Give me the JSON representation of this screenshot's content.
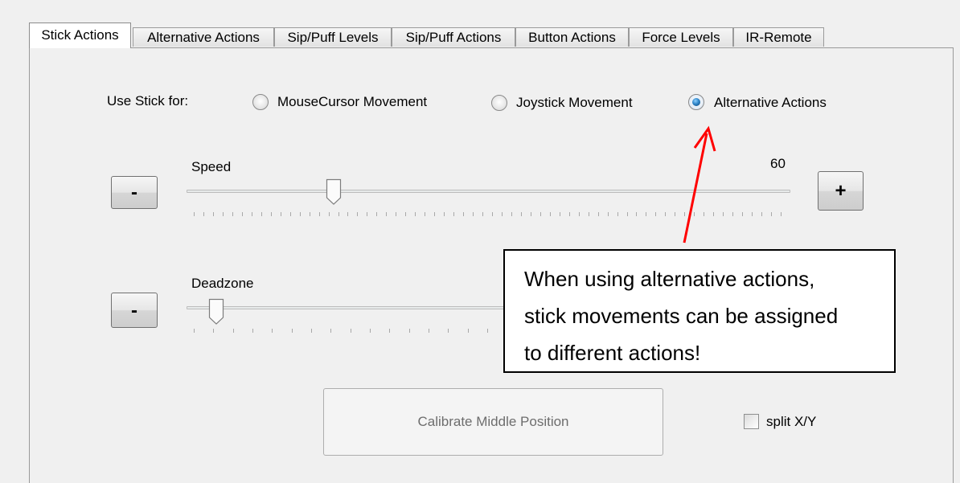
{
  "tabs": [
    {
      "label": "Stick Actions",
      "active": true
    },
    {
      "label": "Alternative Actions"
    },
    {
      "label": "Sip/Puff Levels"
    },
    {
      "label": "Sip/Puff Actions"
    },
    {
      "label": "Button Actions"
    },
    {
      "label": "Force Levels"
    },
    {
      "label": "IR-Remote"
    }
  ],
  "stick_mode": {
    "label": "Use Stick for:",
    "options": [
      {
        "label": "MouseCursor Movement",
        "checked": false
      },
      {
        "label": "Joystick Movement",
        "checked": false
      },
      {
        "label": "Alternative Actions",
        "checked": true
      }
    ]
  },
  "speed": {
    "label": "Speed",
    "value": "60",
    "minus_label": "-",
    "plus_label": "+",
    "level": 0.24
  },
  "deadzone": {
    "label": "Deadzone",
    "minus_label": "-",
    "level": 0.04
  },
  "calibrate_label": "Calibrate Middle Position",
  "split_xy": {
    "label": "split X/Y",
    "checked": false
  },
  "callout": {
    "line1": "When using alternative actions,",
    "line2": "stick movements can be assigned",
    "line3": "to different actions!"
  },
  "colors": {
    "arrow": "#ff0000",
    "radio_selected": "#2f86c9",
    "disabled_text": "#6d6d6d"
  }
}
